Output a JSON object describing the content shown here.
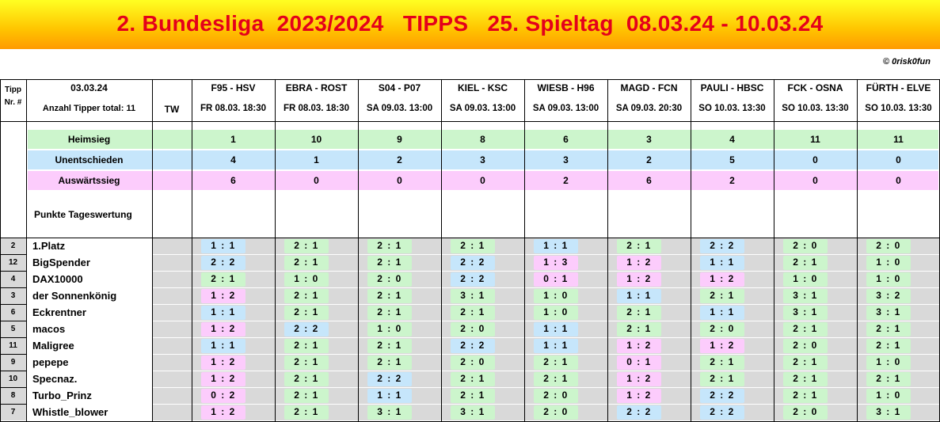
{
  "header": {
    "title": "2. Bundesliga  2023/2024   TIPPS   25. Spieltag  08.03.24 - 10.03.24",
    "copyright": "© 0risk0fun"
  },
  "table_head": {
    "tipp_label_1": "Tipp",
    "tipp_label_2": "Nr. #",
    "date": "03.03.24",
    "tipper_count": "Anzahl Tipper total:  11",
    "tw_label": "TW"
  },
  "matches": [
    {
      "pair": "F95 - HSV",
      "time": "FR 08.03. 18:30"
    },
    {
      "pair": "EBRA - ROST",
      "time": "FR 08.03. 18:30"
    },
    {
      "pair": "S04 - P07",
      "time": "SA 09.03. 13:00"
    },
    {
      "pair": "KIEL - KSC",
      "time": "SA 09.03. 13:00"
    },
    {
      "pair": "WIESB - H96",
      "time": "SA 09.03. 13:00"
    },
    {
      "pair": "MAGD - FCN",
      "time": "SA 09.03. 20:30"
    },
    {
      "pair": "PAULI - HBSC",
      "time": "SO 10.03. 13:30"
    },
    {
      "pair": "FCK - OSNA",
      "time": "SO 10.03. 13:30"
    },
    {
      "pair": "FÜRTH - ELVE",
      "time": "SO 10.03. 13:30"
    }
  ],
  "stats": [
    {
      "label": "Heimsieg",
      "color": "#ccf5cc",
      "values": [
        "1",
        "10",
        "9",
        "8",
        "6",
        "3",
        "4",
        "11",
        "11"
      ]
    },
    {
      "label": "Unentschieden",
      "color": "#c6e6fb",
      "values": [
        "4",
        "1",
        "2",
        "3",
        "3",
        "2",
        "5",
        "0",
        "0"
      ]
    },
    {
      "label": "Auswärtssieg",
      "color": "#fcccfc",
      "values": [
        "6",
        "0",
        "0",
        "0",
        "2",
        "6",
        "2",
        "0",
        "0"
      ]
    }
  ],
  "day_score_label": "Punkte Tageswertung",
  "tip_colors": {
    "H": "#ccf5cc",
    "D": "#c6e6fb",
    "A": "#fcccfc"
  },
  "players": [
    {
      "num": "2",
      "name": "1.Platz",
      "tips": [
        "1 : 1",
        "2 : 1",
        "2 : 1",
        "2 : 1",
        "1 : 1",
        "2 : 1",
        "2 : 2",
        "2 : 0",
        "2 : 0"
      ]
    },
    {
      "num": "12",
      "name": "BigSpender",
      "tips": [
        "2 : 2",
        "2 : 1",
        "2 : 1",
        "2 : 2",
        "1 : 3",
        "1 : 2",
        "1 : 1",
        "2 : 1",
        "1 : 0"
      ]
    },
    {
      "num": "4",
      "name": "DAX10000",
      "tips": [
        "2 : 1",
        "1 : 0",
        "2 : 0",
        "2 : 2",
        "0 : 1",
        "1 : 2",
        "1 : 2",
        "1 : 0",
        "1 : 0"
      ]
    },
    {
      "num": "3",
      "name": "der Sonnenkönig",
      "tips": [
        "1 : 2",
        "2 : 1",
        "2 : 1",
        "3 : 1",
        "1 : 0",
        "1 : 1",
        "2 : 1",
        "3 : 1",
        "3 : 2"
      ]
    },
    {
      "num": "6",
      "name": "Eckrentner",
      "tips": [
        "1 : 1",
        "2 : 1",
        "2 : 1",
        "2 : 1",
        "1 : 0",
        "2 : 1",
        "1 : 1",
        "3 : 1",
        "3 : 1"
      ]
    },
    {
      "num": "5",
      "name": "macos",
      "tips": [
        "1 : 2",
        "2 : 2",
        "1 : 0",
        "2 : 0",
        "1 : 1",
        "2 : 1",
        "2 : 0",
        "2 : 1",
        "2 : 1"
      ]
    },
    {
      "num": "11",
      "name": "Maligree",
      "tips": [
        "1 : 1",
        "2 : 1",
        "2 : 1",
        "2 : 2",
        "1 : 1",
        "1 : 2",
        "1 : 2",
        "2 : 0",
        "2 : 1"
      ]
    },
    {
      "num": "9",
      "name": "pepepe",
      "tips": [
        "1 : 2",
        "2 : 1",
        "2 : 1",
        "2 : 0",
        "2 : 1",
        "0 : 1",
        "2 : 1",
        "2 : 1",
        "1 : 0"
      ]
    },
    {
      "num": "10",
      "name": "Specnaz.",
      "tips": [
        "1 : 2",
        "2 : 1",
        "2 : 2",
        "2 : 1",
        "2 : 1",
        "1 : 2",
        "2 : 1",
        "2 : 1",
        "2 : 1"
      ]
    },
    {
      "num": "8",
      "name": "Turbo_Prinz",
      "tips": [
        "0 : 2",
        "2 : 1",
        "1 : 1",
        "2 : 1",
        "2 : 0",
        "1 : 2",
        "2 : 2",
        "2 : 1",
        "1 : 0"
      ]
    },
    {
      "num": "7",
      "name": "Whistle_blower",
      "tips": [
        "1 : 2",
        "2 : 1",
        "3 : 1",
        "3 : 1",
        "2 : 0",
        "2 : 2",
        "2 : 2",
        "2 : 0",
        "3 : 1"
      ]
    }
  ]
}
